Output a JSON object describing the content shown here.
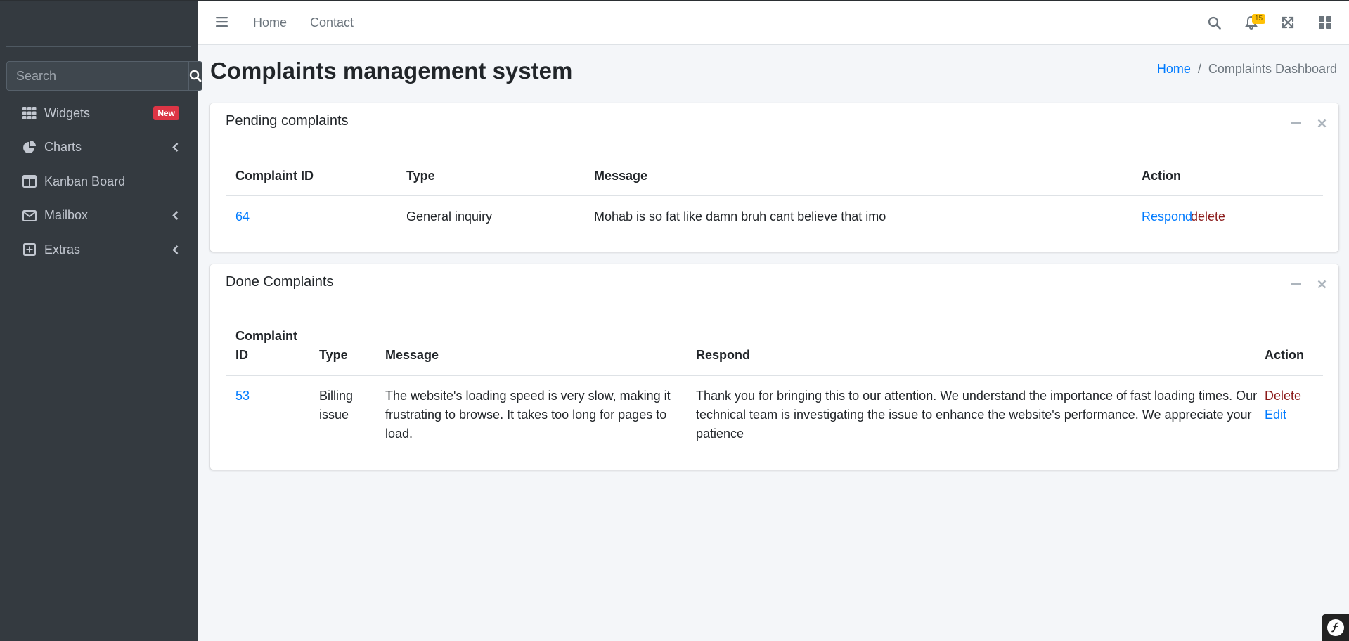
{
  "sidebar": {
    "search_placeholder": "Search",
    "items": [
      {
        "label": "Widgets",
        "icon": "th-icon",
        "badge": "New"
      },
      {
        "label": "Charts",
        "icon": "pie-chart-icon"
      },
      {
        "label": "Kanban Board",
        "icon": "columns-icon"
      },
      {
        "label": "Mailbox",
        "icon": "envelope-icon"
      },
      {
        "label": "Extras",
        "icon": "plus-square-icon"
      }
    ]
  },
  "topbar": {
    "links": [
      "Home",
      "Contact"
    ],
    "notification_count": "15"
  },
  "header": {
    "title": "Complaints management system",
    "breadcrumb": {
      "home": "Home",
      "separator": "/",
      "current": "Complaints Dashboard"
    }
  },
  "pending": {
    "title": "Pending complaints",
    "columns": [
      "Complaint ID",
      "Type",
      "Message",
      "Action"
    ],
    "rows": [
      {
        "id": "64",
        "type": "General inquiry",
        "message": "Mohab is so fat like damn bruh cant believe that imo",
        "respond": "Respond",
        "delete": "delete"
      }
    ]
  },
  "done": {
    "title": "Done Complaints",
    "columns": {
      "id_line1": "Complaint",
      "id_line2": "ID",
      "type": "Type",
      "message": "Message",
      "respond": "Respond",
      "action": "Action"
    },
    "rows": [
      {
        "id": "53",
        "type_line1": "Billing",
        "type_line2": "issue",
        "message_line1": "The website's loading speed is very slow, making it",
        "message_line2": "frustrating to browse. It takes too long for pages to",
        "message_line3": "load.",
        "respond_line1": "Thank you for bringing this to our attention. We understand the importance of fast loading times. Our",
        "respond_line2": "technical team is investigating the issue to enhance the website's performance. We appreciate your",
        "respond_line3": "patience",
        "delete": "Delete",
        "edit": "Edit"
      }
    ]
  },
  "colors": {
    "sidebar_bg": "#343a40",
    "link": "#007bff",
    "danger_link": "#8b1a1a",
    "badge_new": "#dc3545",
    "notif_badge": "#ffc107"
  }
}
